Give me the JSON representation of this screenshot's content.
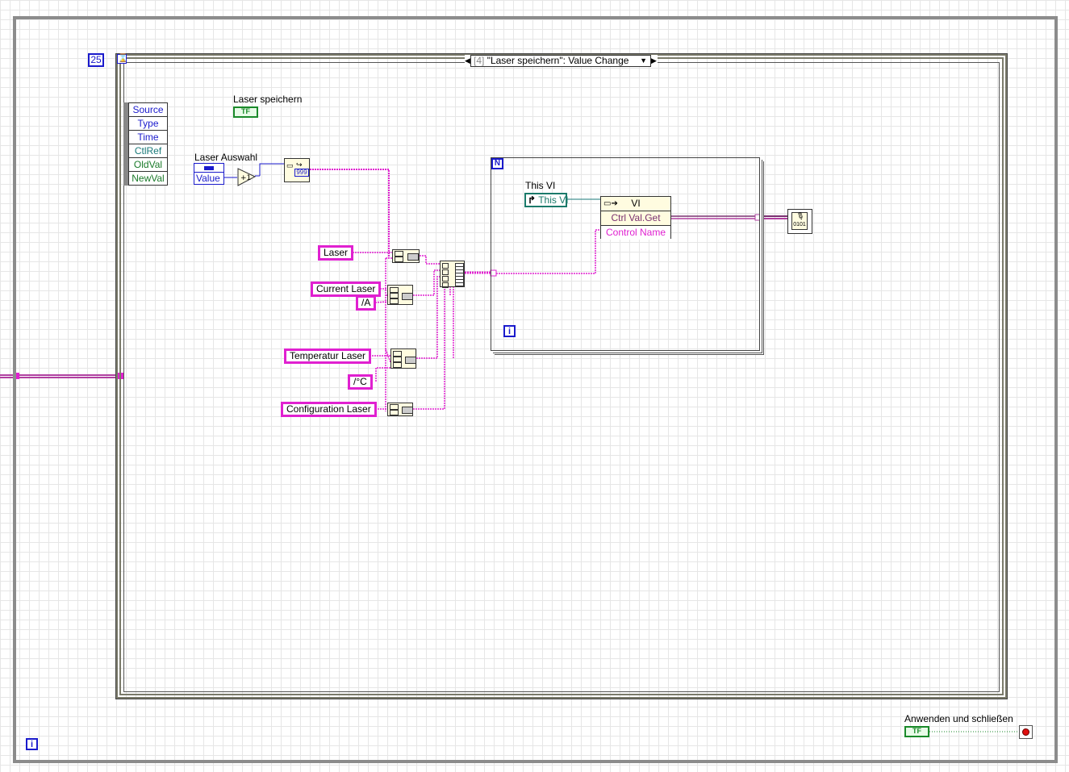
{
  "while_loop": {
    "iteration_label": "i",
    "stop_label": "Anwenden und schließen",
    "bool_const": "TF"
  },
  "event_structure": {
    "timeout_const": "25",
    "case_index": "[4]",
    "case_label": "\"Laser speichern\": Value Change",
    "event_data": [
      "Source",
      "Type",
      "Time",
      "CtlRef",
      "OldVal",
      "NewVal"
    ]
  },
  "controls": {
    "laser_speichern_label": "Laser speichern",
    "laser_auswahl_label": "Laser Auswahl",
    "laser_auswahl_value": "Value",
    "bool_const": "TF",
    "num_format": "999"
  },
  "string_constants": [
    "Laser",
    "Current Laser",
    "/A",
    "Temperatur Laser",
    "/°C",
    "Configuration Laser"
  ],
  "for_loop": {
    "count_label": "N",
    "iteration_label": "i",
    "this_vi_label": "This VI",
    "this_vi_const": "This VI",
    "property_node": {
      "class": "VI",
      "method": "Ctrl Val.Get",
      "param": "Control Name"
    }
  },
  "colors": {
    "string_wire": "#e020d0",
    "refnum_wire": "#1a7a7a",
    "bool_wire": "#1a8a2a",
    "numeric_wire": "#1a1acc",
    "array_wire": "#b040a0"
  },
  "icons": [
    "hourglass-icon",
    "format-into-string-icon",
    "build-array-icon",
    "concatenate-icon",
    "flatten-to-string-icon",
    "stop-icon"
  ]
}
